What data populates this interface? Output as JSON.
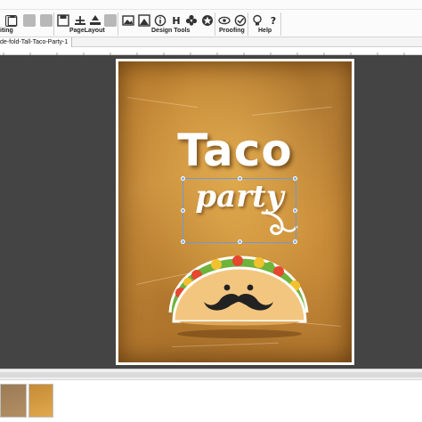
{
  "toolbar": {
    "groups": [
      {
        "label": "iting"
      },
      {
        "label": "PageLayout"
      },
      {
        "label": "Design Tools"
      },
      {
        "label": "Proofing"
      },
      {
        "label": "Help"
      }
    ],
    "icons": [
      "rect-icon",
      "paste-icon",
      "undo-icon",
      "redo-icon",
      "save-icon",
      "plus-icon",
      "align-icon",
      "gear-icon",
      "image-icon",
      "photo-icon",
      "info-icon",
      "h-icon",
      "flower-icon",
      "star-icon",
      "eye-icon",
      "spell-icon",
      "bulb-icon",
      "question-icon"
    ]
  },
  "document": {
    "tab_title": "de-fold-Tall-Taco-Party-1"
  },
  "poster": {
    "title": "Taco",
    "subtitle": "party"
  },
  "colors": {
    "canvas": "#444444",
    "poster_base": "#d4963e",
    "selection": "#6b9bd8",
    "taco_shell": "#f3c680"
  },
  "thumbnails": [
    {
      "name": "page-thumbnail-1"
    },
    {
      "name": "page-thumbnail-2"
    }
  ]
}
